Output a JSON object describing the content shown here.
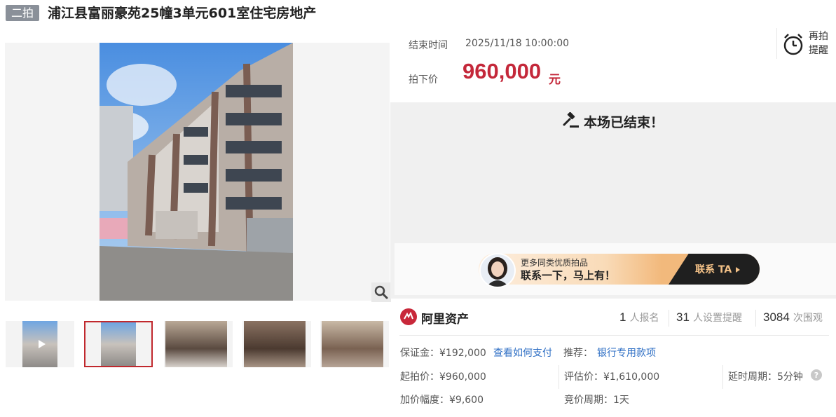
{
  "header": {
    "badge": "二拍",
    "title": "浦江县富丽豪苑25幢3单元601室住宅房地产"
  },
  "auction": {
    "end_time_label": "结束时间",
    "end_time": "2025/11/18 10:00:00",
    "final_price_label": "拍下价",
    "final_price": "960,000",
    "price_unit": "元",
    "remind_label": "再拍提醒",
    "ended_message": "本场已结束！"
  },
  "promo": {
    "line1": "更多同类优质拍品",
    "line2": "联系一下，马上有！",
    "button": "联系 TA",
    "colors": {
      "accent": "#c4283a",
      "dark": "#1f1f1f",
      "gold": "#f2b97c"
    }
  },
  "platform": {
    "name": "阿里资产"
  },
  "stats": [
    {
      "num": "1",
      "label": "人报名"
    },
    {
      "num": "31",
      "label": "人设置提醒"
    },
    {
      "num": "3084",
      "label": "次围观"
    }
  ],
  "details": {
    "deposit": "保证金：¥192,000",
    "how_to_pay": "查看如何支付",
    "recommend_label": "推荐：",
    "recommend_link": "银行专用款项",
    "start_price": "起拍价：¥960,000",
    "valuation": "评估价：¥1,610,000",
    "delay": "延时周期：5分钟",
    "increment": "加价幅度：¥9,600",
    "bid_period": "竞价周期：1天"
  },
  "icons": [
    "alarm-clock-icon",
    "gavel-icon",
    "zoom-icon",
    "play-icon",
    "help-icon",
    "caret-right-icon",
    "ali-logo-icon"
  ]
}
